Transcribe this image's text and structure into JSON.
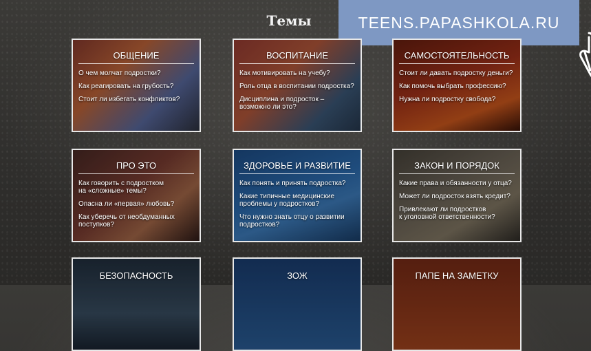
{
  "page": {
    "title": "Темы",
    "site_banner": "TEENS.PAPASHKOLA.RU"
  },
  "topics": [
    {
      "title": "ОБЩЕНИЕ",
      "links": [
        "О чем молчат подростки?",
        "Как реагировать на грубость?",
        "Стоит ли избегать конфликтов?"
      ]
    },
    {
      "title": "ВОСПИТАНИЕ",
      "links": [
        "Как мотивировать на учебу?",
        "Роль отца в воспитании подростка?",
        "Дисциплина и подросток –\nвозможно ли это?"
      ]
    },
    {
      "title": "САМОСТОЯТЕЛЬНОСТЬ",
      "links": [
        "Стоит ли давать подростку деньги?",
        "Как помочь выбрать профессию?",
        "Нужна ли подростку свобода?"
      ]
    },
    {
      "title": "ПРО ЭТО",
      "links": [
        "Как говорить с подростком\nна «сложные» темы?",
        "Опасна ли «первая» любовь?",
        "Как уберечь от необдуманных\nпоступков?"
      ]
    },
    {
      "title": "ЗДОРОВЬЕ И РАЗВИТИЕ",
      "links": [
        "Как понять и принять подростка?",
        "Какие типичные медицинские\nпроблемы у подростков?",
        "Что нужно знать отцу о развитии\nподростков?"
      ]
    },
    {
      "title": "ЗАКОН И ПОРЯДОК",
      "links": [
        "Какие права и обязанности у отца?",
        "Может ли подросток взять кредит?",
        "Привлекают ли подростков\nк уголовной ответственности?"
      ]
    },
    {
      "title": "БЕЗОПАСНОСТЬ",
      "links": []
    },
    {
      "title": "ЗОЖ",
      "links": []
    },
    {
      "title": "ПАПЕ НА ЗАМЕТКУ",
      "links": []
    }
  ],
  "icons": {
    "cursor": "hand-pointer-icon"
  },
  "colors": {
    "banner": "#7e98c3",
    "background": "#333230",
    "card_border": "#e8e8e8"
  }
}
